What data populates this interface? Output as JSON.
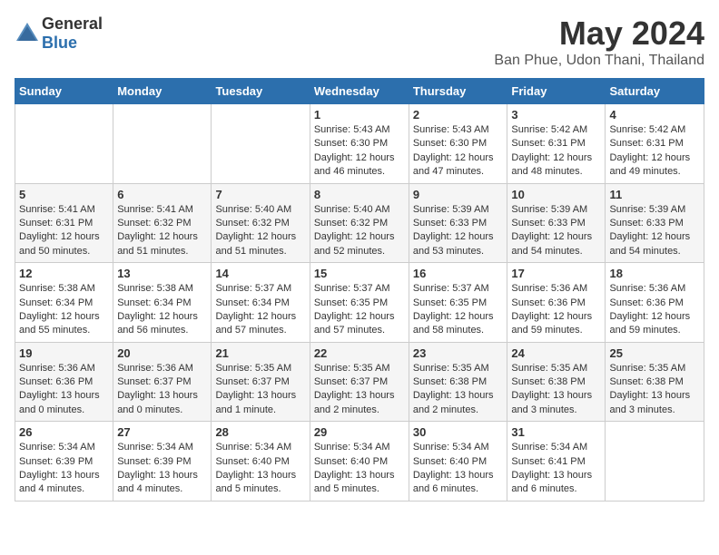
{
  "logo": {
    "general": "General",
    "blue": "Blue"
  },
  "header": {
    "month": "May 2024",
    "location": "Ban Phue, Udon Thani, Thailand"
  },
  "weekdays": [
    "Sunday",
    "Monday",
    "Tuesday",
    "Wednesday",
    "Thursday",
    "Friday",
    "Saturday"
  ],
  "weeks": [
    [
      {
        "day": "",
        "text": ""
      },
      {
        "day": "",
        "text": ""
      },
      {
        "day": "",
        "text": ""
      },
      {
        "day": "1",
        "text": "Sunrise: 5:43 AM\nSunset: 6:30 PM\nDaylight: 12 hours and 46 minutes."
      },
      {
        "day": "2",
        "text": "Sunrise: 5:43 AM\nSunset: 6:30 PM\nDaylight: 12 hours and 47 minutes."
      },
      {
        "day": "3",
        "text": "Sunrise: 5:42 AM\nSunset: 6:31 PM\nDaylight: 12 hours and 48 minutes."
      },
      {
        "day": "4",
        "text": "Sunrise: 5:42 AM\nSunset: 6:31 PM\nDaylight: 12 hours and 49 minutes."
      }
    ],
    [
      {
        "day": "5",
        "text": "Sunrise: 5:41 AM\nSunset: 6:31 PM\nDaylight: 12 hours and 50 minutes."
      },
      {
        "day": "6",
        "text": "Sunrise: 5:41 AM\nSunset: 6:32 PM\nDaylight: 12 hours and 51 minutes."
      },
      {
        "day": "7",
        "text": "Sunrise: 5:40 AM\nSunset: 6:32 PM\nDaylight: 12 hours and 51 minutes."
      },
      {
        "day": "8",
        "text": "Sunrise: 5:40 AM\nSunset: 6:32 PM\nDaylight: 12 hours and 52 minutes."
      },
      {
        "day": "9",
        "text": "Sunrise: 5:39 AM\nSunset: 6:33 PM\nDaylight: 12 hours and 53 minutes."
      },
      {
        "day": "10",
        "text": "Sunrise: 5:39 AM\nSunset: 6:33 PM\nDaylight: 12 hours and 54 minutes."
      },
      {
        "day": "11",
        "text": "Sunrise: 5:39 AM\nSunset: 6:33 PM\nDaylight: 12 hours and 54 minutes."
      }
    ],
    [
      {
        "day": "12",
        "text": "Sunrise: 5:38 AM\nSunset: 6:34 PM\nDaylight: 12 hours and 55 minutes."
      },
      {
        "day": "13",
        "text": "Sunrise: 5:38 AM\nSunset: 6:34 PM\nDaylight: 12 hours and 56 minutes."
      },
      {
        "day": "14",
        "text": "Sunrise: 5:37 AM\nSunset: 6:34 PM\nDaylight: 12 hours and 57 minutes."
      },
      {
        "day": "15",
        "text": "Sunrise: 5:37 AM\nSunset: 6:35 PM\nDaylight: 12 hours and 57 minutes."
      },
      {
        "day": "16",
        "text": "Sunrise: 5:37 AM\nSunset: 6:35 PM\nDaylight: 12 hours and 58 minutes."
      },
      {
        "day": "17",
        "text": "Sunrise: 5:36 AM\nSunset: 6:36 PM\nDaylight: 12 hours and 59 minutes."
      },
      {
        "day": "18",
        "text": "Sunrise: 5:36 AM\nSunset: 6:36 PM\nDaylight: 12 hours and 59 minutes."
      }
    ],
    [
      {
        "day": "19",
        "text": "Sunrise: 5:36 AM\nSunset: 6:36 PM\nDaylight: 13 hours and 0 minutes."
      },
      {
        "day": "20",
        "text": "Sunrise: 5:36 AM\nSunset: 6:37 PM\nDaylight: 13 hours and 0 minutes."
      },
      {
        "day": "21",
        "text": "Sunrise: 5:35 AM\nSunset: 6:37 PM\nDaylight: 13 hours and 1 minute."
      },
      {
        "day": "22",
        "text": "Sunrise: 5:35 AM\nSunset: 6:37 PM\nDaylight: 13 hours and 2 minutes."
      },
      {
        "day": "23",
        "text": "Sunrise: 5:35 AM\nSunset: 6:38 PM\nDaylight: 13 hours and 2 minutes."
      },
      {
        "day": "24",
        "text": "Sunrise: 5:35 AM\nSunset: 6:38 PM\nDaylight: 13 hours and 3 minutes."
      },
      {
        "day": "25",
        "text": "Sunrise: 5:35 AM\nSunset: 6:38 PM\nDaylight: 13 hours and 3 minutes."
      }
    ],
    [
      {
        "day": "26",
        "text": "Sunrise: 5:34 AM\nSunset: 6:39 PM\nDaylight: 13 hours and 4 minutes."
      },
      {
        "day": "27",
        "text": "Sunrise: 5:34 AM\nSunset: 6:39 PM\nDaylight: 13 hours and 4 minutes."
      },
      {
        "day": "28",
        "text": "Sunrise: 5:34 AM\nSunset: 6:40 PM\nDaylight: 13 hours and 5 minutes."
      },
      {
        "day": "29",
        "text": "Sunrise: 5:34 AM\nSunset: 6:40 PM\nDaylight: 13 hours and 5 minutes."
      },
      {
        "day": "30",
        "text": "Sunrise: 5:34 AM\nSunset: 6:40 PM\nDaylight: 13 hours and 6 minutes."
      },
      {
        "day": "31",
        "text": "Sunrise: 5:34 AM\nSunset: 6:41 PM\nDaylight: 13 hours and 6 minutes."
      },
      {
        "day": "",
        "text": ""
      }
    ]
  ]
}
